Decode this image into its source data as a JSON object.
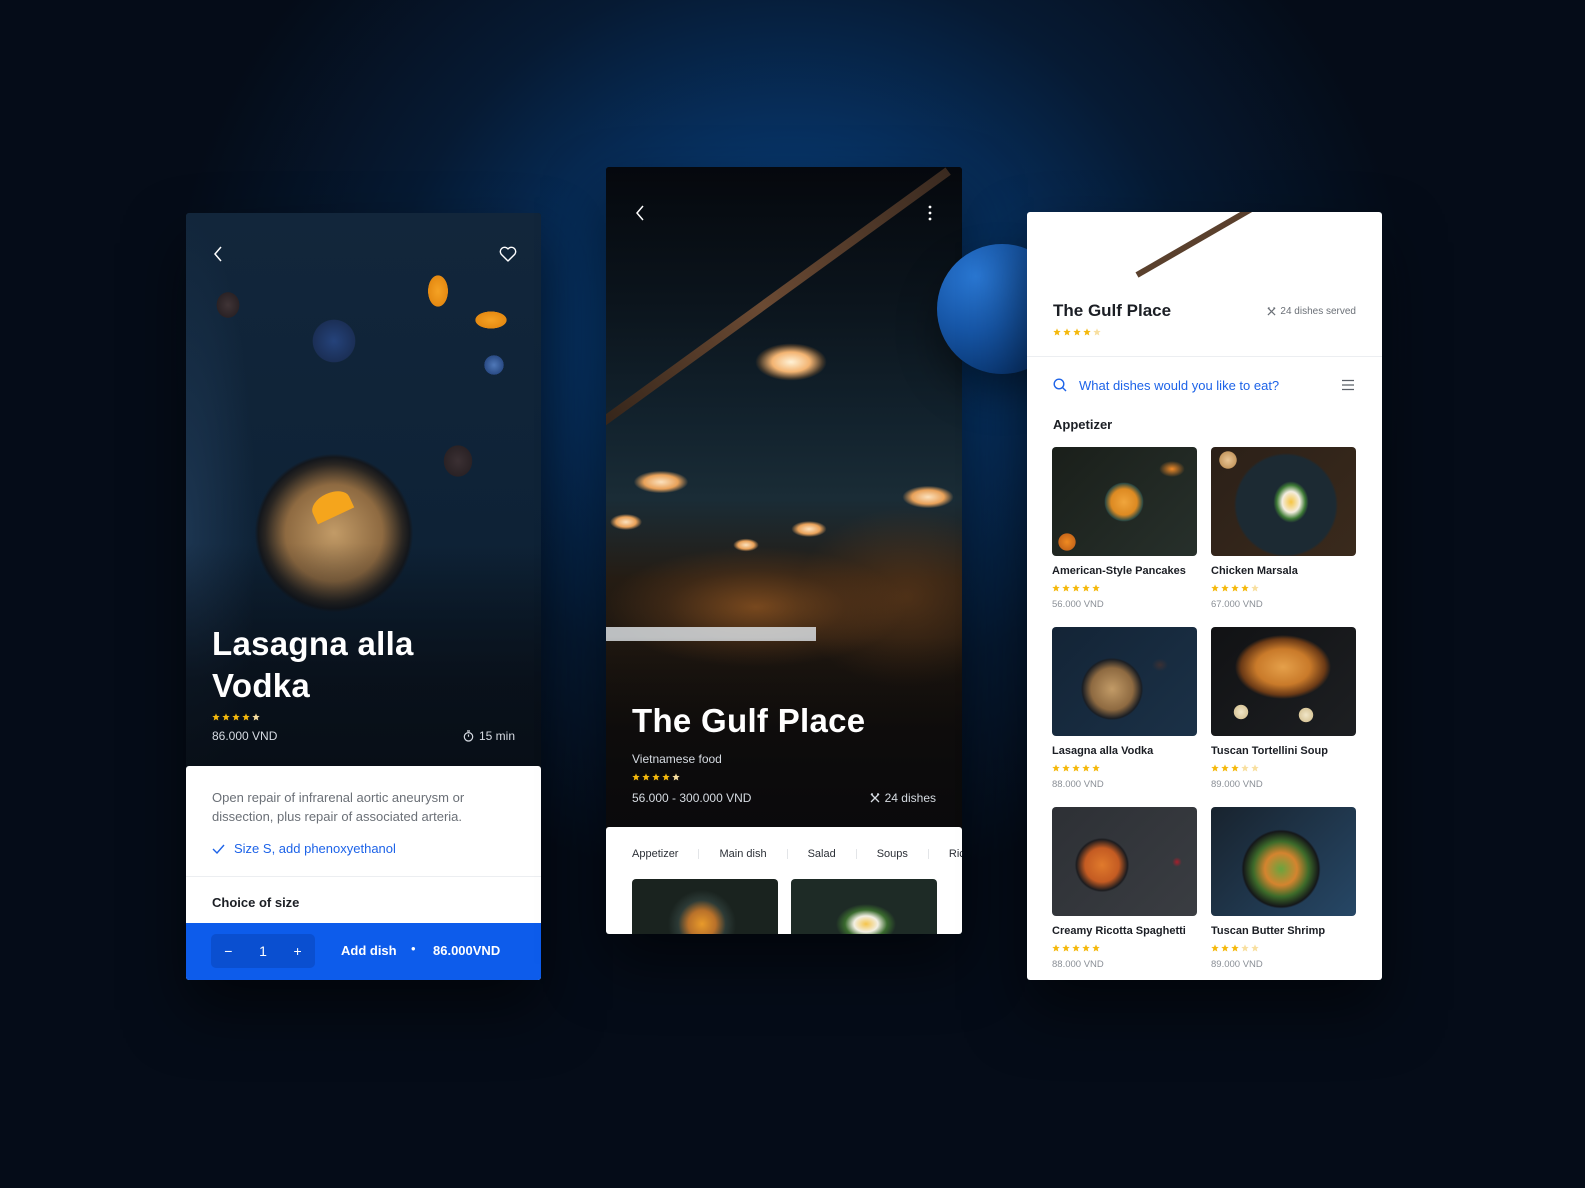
{
  "colors": {
    "accent": "#0d5ceb",
    "link": "#1d63e8",
    "star_on": "#f5b90d",
    "star_off": "#f8dfa0"
  },
  "dish_screen": {
    "back_icon": "chevron-left-icon",
    "favorite_icon": "heart-icon",
    "title": "Lasagna alla Vodka",
    "rating": 4,
    "rating_max": 5,
    "price": "86.000 VND",
    "time_icon": "stopwatch-icon",
    "time": "15 min",
    "description": "Open repair of infrarenal aortic aneurysm or dissection, plus repair of associated arteria.",
    "option_icon": "check-icon",
    "option": "Size S, add phenoxyethanol",
    "choice_heading": "Choice of size",
    "cta": {
      "decrement_label": "−",
      "quantity": "1",
      "increment_label": "+",
      "add_label": "Add dish",
      "separator": "•",
      "total": "86.000VND"
    }
  },
  "restaurant_screen": {
    "back_icon": "chevron-left-icon",
    "more_icon": "more-vertical-icon",
    "title": "The Gulf Place",
    "subtitle": "Vietnamese food",
    "rating": 4,
    "rating_max": 5,
    "price_range": "56.000 - 300.000 VND",
    "dishes_icon": "utensils-icon",
    "dishes_count": "24 dishes",
    "tabs": [
      {
        "label": "Appetizer"
      },
      {
        "label": "Main dish"
      },
      {
        "label": "Salad"
      },
      {
        "label": "Soups"
      },
      {
        "label": "Rice"
      }
    ]
  },
  "menu_screen": {
    "back_icon": "chevron-left-icon",
    "favorite_icon": "heart-icon",
    "info_icon": "info-icon",
    "restaurant_name": "The Gulf Place",
    "rating": 4,
    "rating_max": 5,
    "dishes_served": "24 dishes served",
    "search_placeholder": "What dishes would you like to eat?",
    "search_value": "",
    "menu_icon": "hamburger-menu-icon",
    "section_title": "Appetizer",
    "dishes": [
      {
        "name": "American-Style Pancakes",
        "rating": 5,
        "price": "56.000 VND"
      },
      {
        "name": "Chicken Marsala",
        "rating": 4,
        "price": "67.000 VND"
      },
      {
        "name": "Lasagna alla Vodka",
        "rating": 5,
        "price": "88.000 VND"
      },
      {
        "name": "Tuscan Tortellini Soup",
        "rating": 3,
        "price": "89.000 VND"
      },
      {
        "name": "Creamy Ricotta Spaghetti",
        "rating": 5,
        "price": "88.000 VND"
      },
      {
        "name": "Tuscan Butter Shrimp",
        "rating": 3,
        "price": "89.000 VND"
      }
    ]
  }
}
